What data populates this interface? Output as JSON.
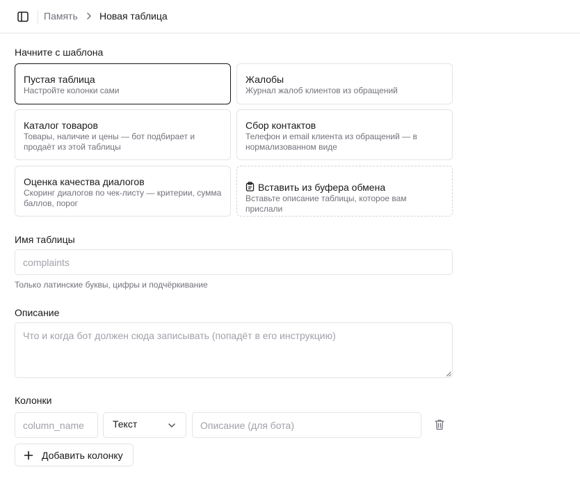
{
  "breadcrumb": {
    "parent": "Память",
    "current": "Новая таблица"
  },
  "templates": {
    "heading": "Начните с шаблона",
    "items": [
      {
        "title": "Пустая таблица",
        "desc": "Настройте колонки сами",
        "selected": true
      },
      {
        "title": "Жалобы",
        "desc": "Журнал жалоб клиентов из обращений"
      },
      {
        "title": "Каталог товаров",
        "desc": "Товары, наличие и цены — бот подбирает и продаёт из этой таблицы"
      },
      {
        "title": "Сбор контактов",
        "desc": "Телефон и email клиента из обращений — в нормализованном виде"
      },
      {
        "title": "Оценка качества диалогов",
        "desc": "Скоринг диалогов по чек-листу — критерии, сумма баллов, порог"
      },
      {
        "title": "Вставить из буфера обмена",
        "desc": "Вставьте описание таблицы, которое вам прислали",
        "icon": "clipboard-icon"
      }
    ]
  },
  "table_name": {
    "label": "Имя таблицы",
    "placeholder": "complaints",
    "value": "",
    "hint": "Только латинские буквы, цифры и подчёркивание"
  },
  "description": {
    "label": "Описание",
    "placeholder": "Что и когда бот должен сюда записывать (попадёт в его инструкцию)",
    "value": ""
  },
  "columns": {
    "label": "Колонки",
    "rows": [
      {
        "name_placeholder": "column_name",
        "type": "Текст",
        "desc_placeholder": "Описание (для бота)"
      }
    ],
    "add_label": "Добавить колонку"
  },
  "icons": {
    "sidebar_toggle": "sidebar-toggle-icon",
    "breadcrumb_separator": "chevron-right-icon",
    "select": "chevron-down-icon",
    "delete": "trash-icon",
    "add": "plus-icon"
  },
  "colors": {
    "border": "#e4e4e7",
    "selected_border": "#18181b",
    "muted_text": "#71717a",
    "placeholder": "#a1a1aa"
  }
}
